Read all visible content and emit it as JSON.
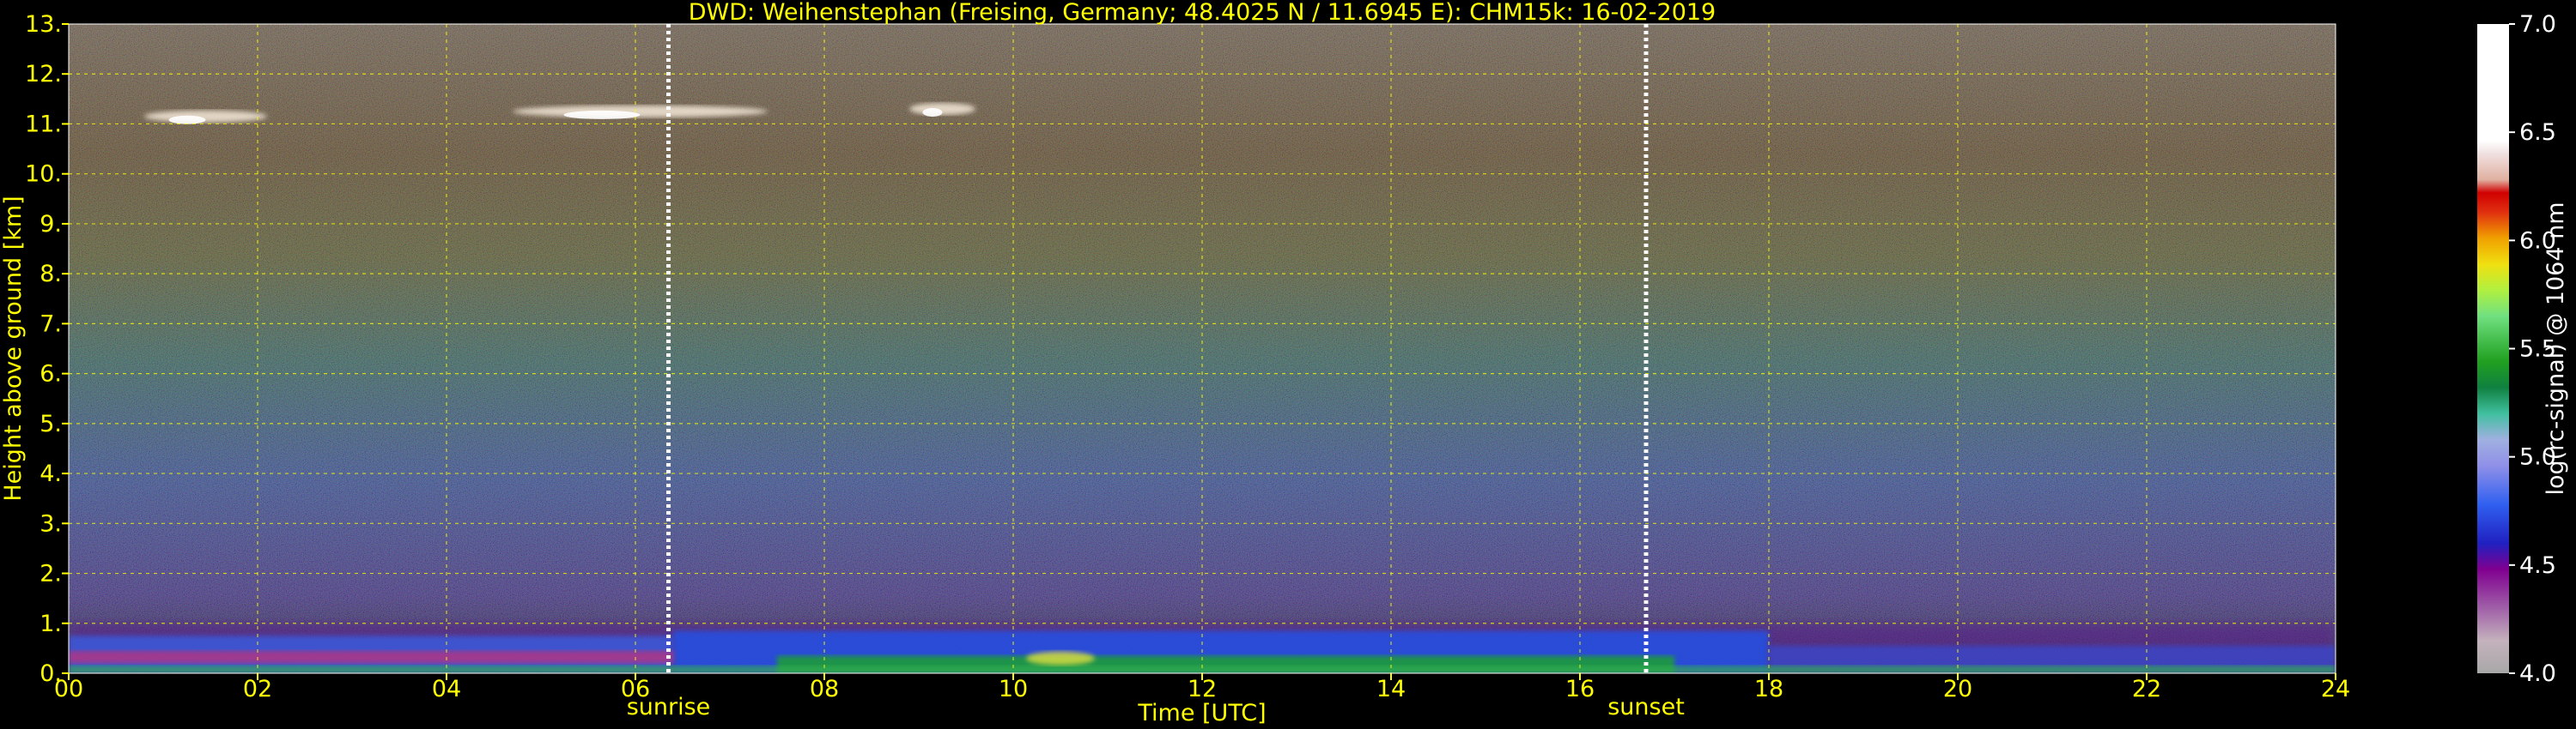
{
  "chart_data": {
    "type": "heatmap",
    "title": "DWD: Weihenstephan (Freising, Germany; 48.4025 N / 11.6945 E):    CHM15k: 16-02-2019",
    "xlabel": "Time [UTC]",
    "ylabel": "Height above ground [km]",
    "xlim": [
      0,
      24
    ],
    "ylim": [
      0,
      13
    ],
    "x_ticks": [
      "00",
      "02",
      "04",
      "06",
      "08",
      "10",
      "12",
      "14",
      "16",
      "18",
      "20",
      "22",
      "24"
    ],
    "y_ticks": [
      "0.",
      "1.",
      "2.",
      "3.",
      "4.",
      "5.",
      "6.",
      "7.",
      "8.",
      "9.",
      "10.",
      "11.",
      "12.",
      "13."
    ],
    "grid": true,
    "colorbar": {
      "label": "log(rc-signal) @ 1064 nm",
      "range": [
        4.0,
        7.0
      ],
      "ticks": [
        "4.0",
        "4.5",
        "5.0",
        "5.5",
        "6.0",
        "6.5",
        "7.0"
      ]
    },
    "annotations": [
      {
        "label": "sunrise",
        "x": 6.35
      },
      {
        "label": "sunset",
        "x": 16.7
      }
    ],
    "features": [
      {
        "type": "cloud",
        "time_range": [
          0.8,
          2.1
        ],
        "height_km": 11.15
      },
      {
        "type": "cloud",
        "time_range": [
          4.7,
          7.4
        ],
        "height_km": 11.25
      },
      {
        "type": "cloud",
        "time_range": [
          8.9,
          9.6
        ],
        "height_km": 11.3
      }
    ]
  },
  "colors": {
    "text": "#ffff00",
    "grid": "#ffff00",
    "background": "#000000",
    "sun_marker": "#ffffff"
  }
}
